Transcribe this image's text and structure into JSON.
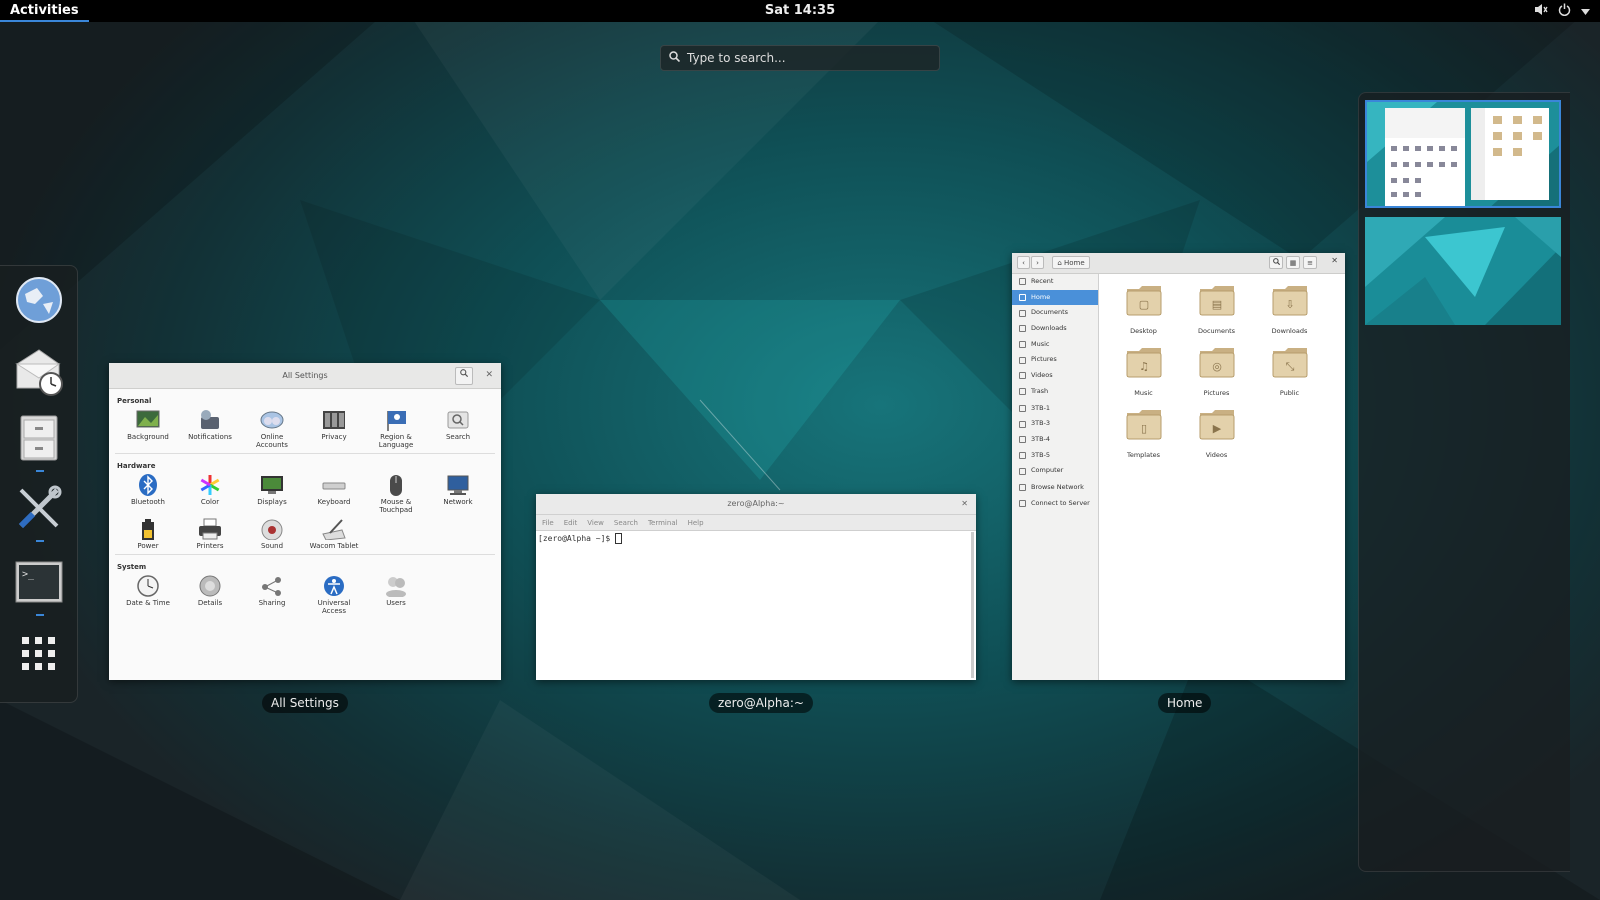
{
  "topbar": {
    "activities": "Activities",
    "clock": "Sat 14:35",
    "tray_icons": [
      "volume-muted-icon",
      "power-icon",
      "chevron-down-icon"
    ]
  },
  "search": {
    "placeholder": "Type to search..."
  },
  "dash": {
    "apps": [
      {
        "name": "web-browser",
        "running": false
      },
      {
        "name": "mail-clock",
        "running": false
      },
      {
        "name": "files",
        "running": true
      },
      {
        "name": "tools",
        "running": true
      },
      {
        "name": "terminal",
        "running": true
      },
      {
        "name": "show-applications",
        "running": false
      }
    ]
  },
  "settings_window": {
    "title": "All Settings",
    "caption": "All Settings",
    "sections": [
      {
        "label": "Personal",
        "items": [
          {
            "label": "Background",
            "icon": "background-icon"
          },
          {
            "label": "Notifications",
            "icon": "notifications-icon"
          },
          {
            "label": "Online\nAccounts",
            "icon": "online-accounts-icon"
          },
          {
            "label": "Privacy",
            "icon": "privacy-icon"
          },
          {
            "label": "Region &\nLanguage",
            "icon": "region-icon"
          },
          {
            "label": "Search",
            "icon": "search-icon"
          }
        ]
      },
      {
        "label": "Hardware",
        "items": [
          {
            "label": "Bluetooth",
            "icon": "bluetooth-icon"
          },
          {
            "label": "Color",
            "icon": "color-icon"
          },
          {
            "label": "Displays",
            "icon": "displays-icon"
          },
          {
            "label": "Keyboard",
            "icon": "keyboard-icon"
          },
          {
            "label": "Mouse &\nTouchpad",
            "icon": "mouse-icon"
          },
          {
            "label": "Network",
            "icon": "network-icon"
          },
          {
            "label": "Power",
            "icon": "power-icon"
          },
          {
            "label": "Printers",
            "icon": "printer-icon"
          },
          {
            "label": "Sound",
            "icon": "sound-icon"
          },
          {
            "label": "Wacom Tablet",
            "icon": "wacom-icon"
          }
        ]
      },
      {
        "label": "System",
        "items": [
          {
            "label": "Date & Time",
            "icon": "clock-icon"
          },
          {
            "label": "Details",
            "icon": "details-icon"
          },
          {
            "label": "Sharing",
            "icon": "sharing-icon"
          },
          {
            "label": "Universal\nAccess",
            "icon": "accessibility-icon"
          },
          {
            "label": "Users",
            "icon": "users-icon"
          }
        ]
      }
    ]
  },
  "terminal_window": {
    "title": "zero@Alpha:~",
    "caption": "zero@Alpha:~",
    "menu": [
      "File",
      "Edit",
      "View",
      "Search",
      "Terminal",
      "Help"
    ],
    "prompt": "[zero@Alpha ~]$ "
  },
  "files_window": {
    "caption": "Home",
    "path_button": "Home",
    "sidebar": [
      {
        "label": "Recent",
        "icon": "clock-icon",
        "selected": false
      },
      {
        "label": "Home",
        "icon": "home-icon",
        "selected": true
      },
      {
        "label": "Documents",
        "icon": "document-icon",
        "selected": false
      },
      {
        "label": "Downloads",
        "icon": "download-icon",
        "selected": false
      },
      {
        "label": "Music",
        "icon": "music-icon",
        "selected": false
      },
      {
        "label": "Pictures",
        "icon": "camera-icon",
        "selected": false
      },
      {
        "label": "Videos",
        "icon": "video-icon",
        "selected": false
      },
      {
        "label": "Trash",
        "icon": "trash-icon",
        "selected": false
      },
      {
        "label": "3TB-1",
        "icon": "drive-icon",
        "selected": false
      },
      {
        "label": "3TB-3",
        "icon": "drive-icon",
        "selected": false
      },
      {
        "label": "3TB-4",
        "icon": "drive-icon",
        "selected": false
      },
      {
        "label": "3TB-5",
        "icon": "drive-icon",
        "selected": false
      },
      {
        "label": "Computer",
        "icon": "drive-icon",
        "selected": false
      },
      {
        "label": "Browse Network",
        "icon": "network-icon",
        "selected": false
      },
      {
        "label": "Connect to Server",
        "icon": "server-icon",
        "selected": false
      }
    ],
    "folders": [
      {
        "label": "Desktop",
        "glyph": "▢"
      },
      {
        "label": "Documents",
        "glyph": "▤"
      },
      {
        "label": "Downloads",
        "glyph": "⇩"
      },
      {
        "label": "Music",
        "glyph": "♫"
      },
      {
        "label": "Pictures",
        "glyph": "◎"
      },
      {
        "label": "Public",
        "glyph": "⤡"
      },
      {
        "label": "Templates",
        "glyph": "▯"
      },
      {
        "label": "Videos",
        "glyph": "▶"
      }
    ]
  },
  "workspaces": {
    "count": 2,
    "active": 1
  }
}
